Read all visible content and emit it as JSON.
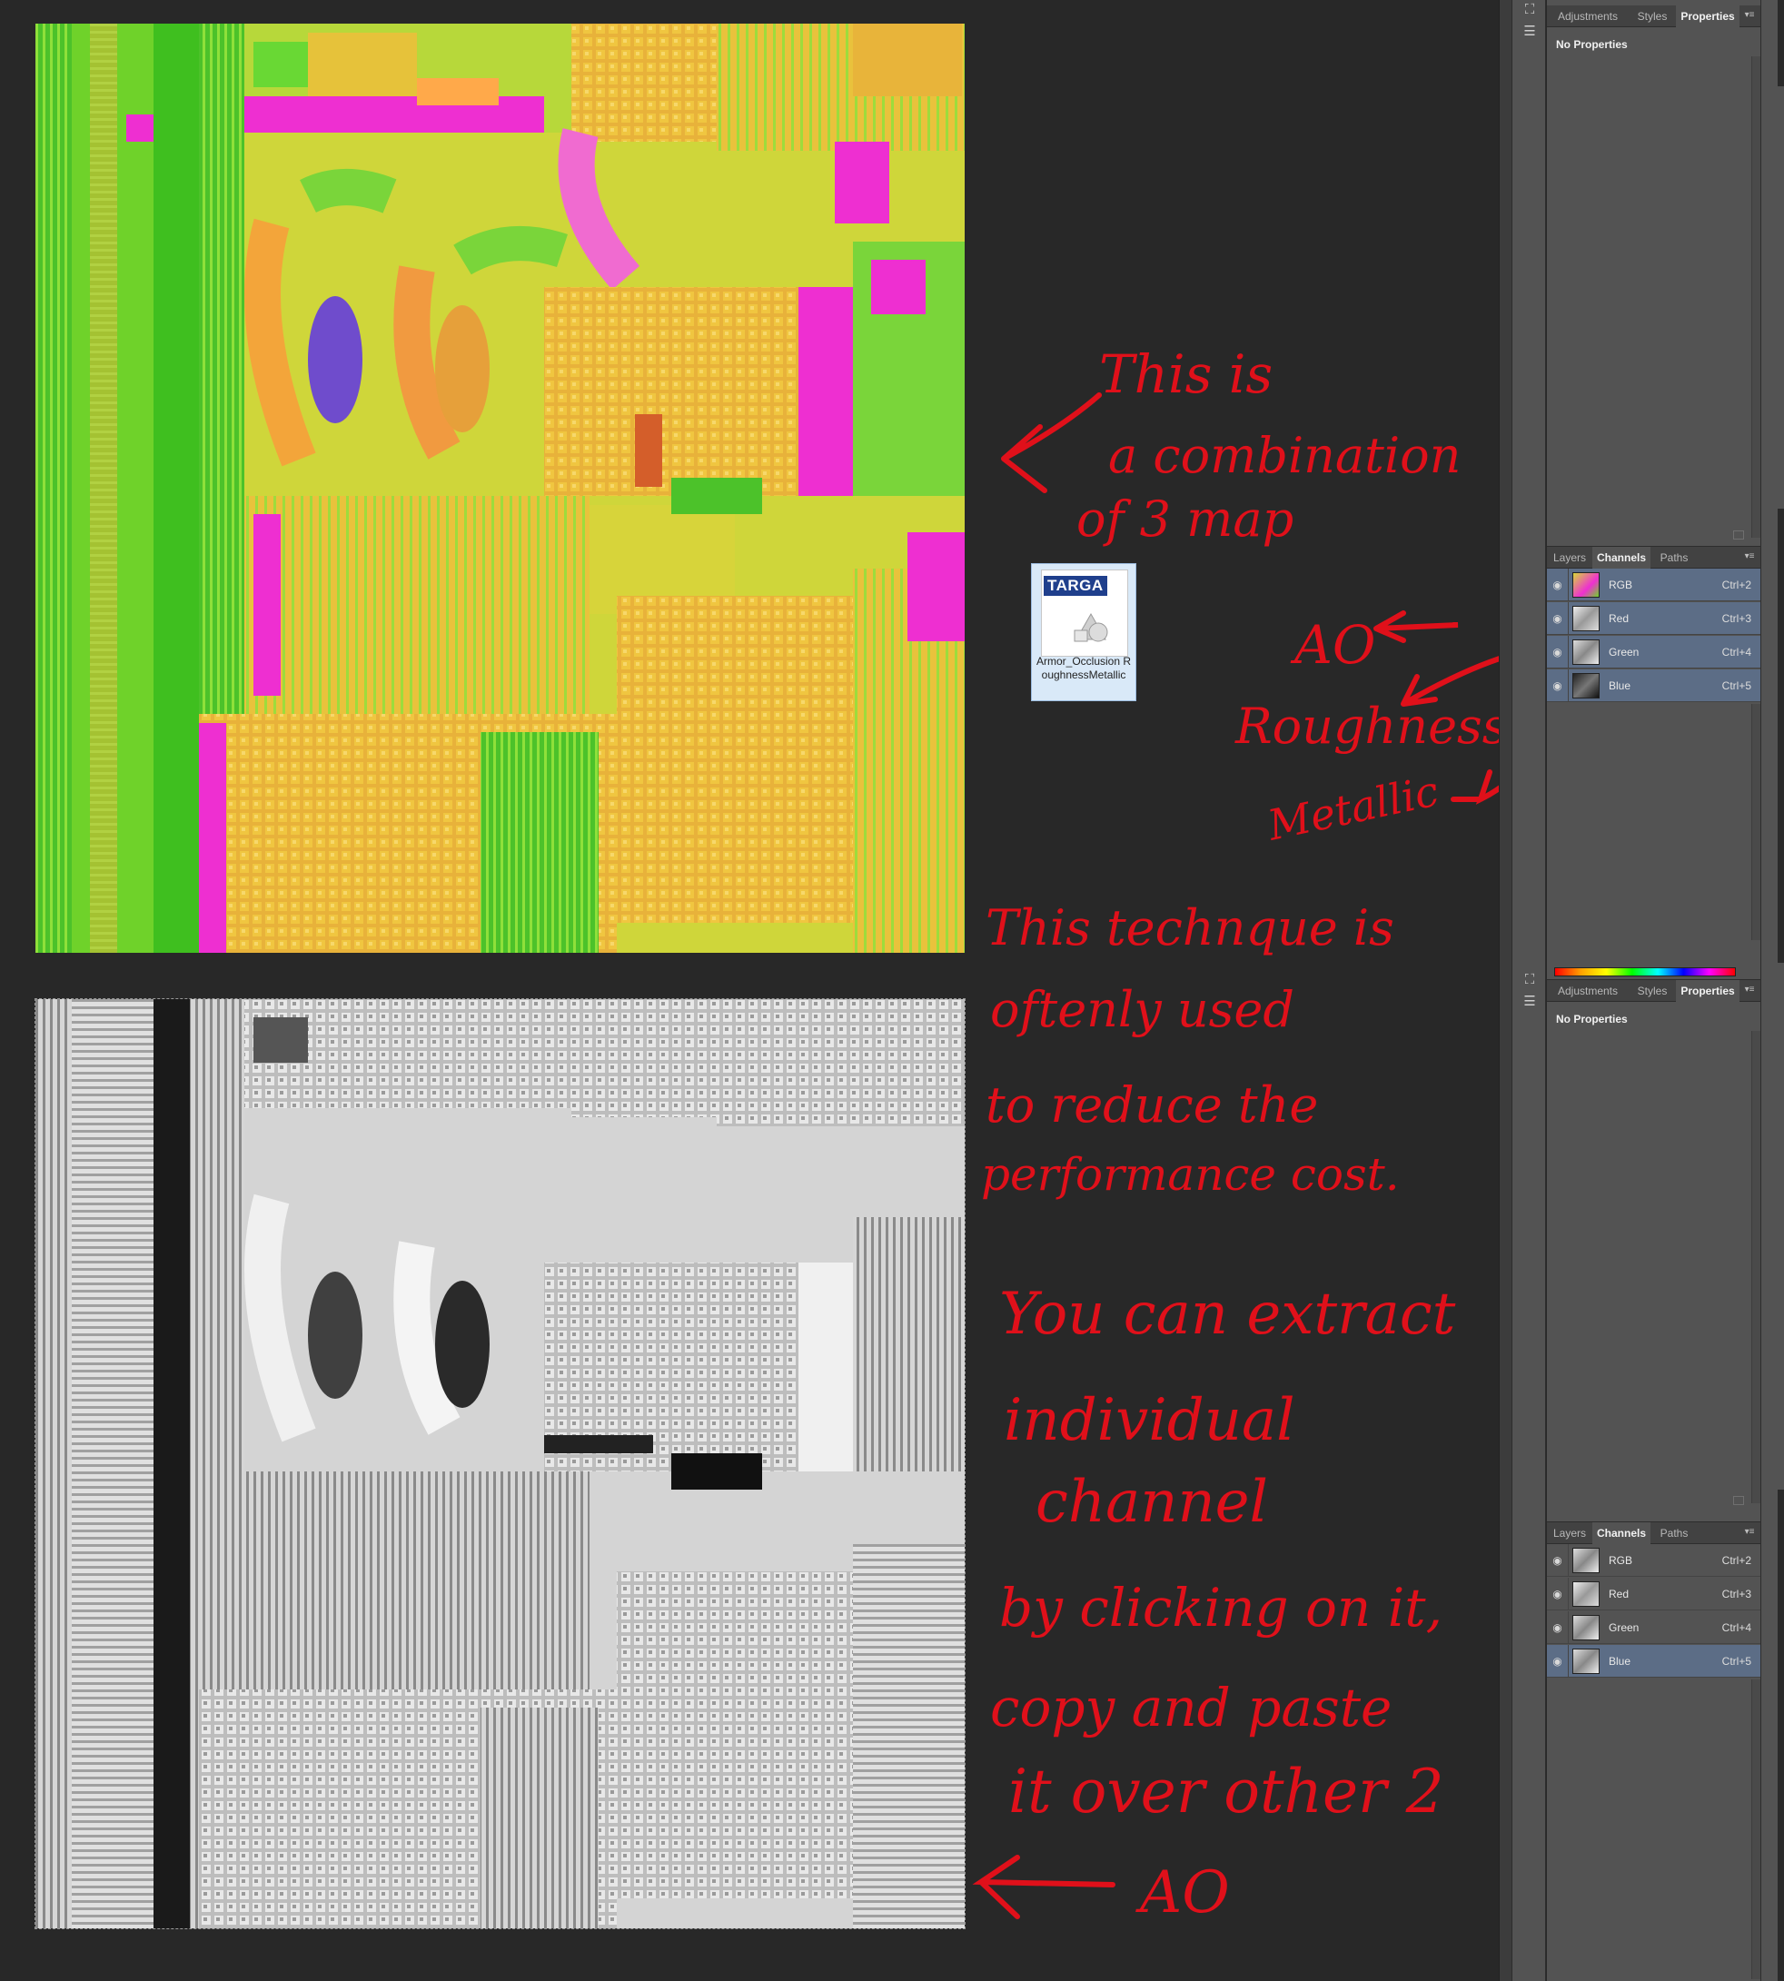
{
  "textures": {
    "combined_alt": "combined AO/Roughness/Metallic texture (yellow-green-pink)",
    "ao_alt": "AO channel grayscale texture"
  },
  "file_icon": {
    "badge": "TARGA",
    "filename": "Armor_Occlusion RoughnessMetallic"
  },
  "annotations": {
    "combo": [
      "This  is",
      "a  combination",
      "of  3 map"
    ],
    "channel_ao": "AO",
    "channel_roughness": "Roughness",
    "channel_metallic": "Metallic",
    "technique": [
      "This  technque is",
      "oftenly  used",
      "to  reduce  the",
      "performance  cost."
    ],
    "extract": [
      "You can  extract",
      "individual",
      "channel",
      "by clicking on it,",
      "copy and  paste",
      "it over other 2"
    ],
    "bottom_ao": "AO",
    "red_two": "2"
  },
  "properties_panel_top": {
    "tabs": [
      "Adjustments",
      "Styles",
      "Properties"
    ],
    "active_tab": "Properties",
    "content": "No Properties"
  },
  "channels_panel_top": {
    "tabs": [
      "Layers",
      "Channels",
      "Paths"
    ],
    "active_tab": "Channels",
    "channels": [
      {
        "name": "RGB",
        "shortcut": "Ctrl+2",
        "selected": true
      },
      {
        "name": "Red",
        "shortcut": "Ctrl+3",
        "selected": true
      },
      {
        "name": "Green",
        "shortcut": "Ctrl+4",
        "selected": true
      },
      {
        "name": "Blue",
        "shortcut": "Ctrl+5",
        "selected": true
      }
    ]
  },
  "properties_panel_bottom": {
    "tabs": [
      "Adjustments",
      "Styles",
      "Properties"
    ],
    "active_tab": "Properties",
    "content": "No Properties"
  },
  "channels_panel_bottom": {
    "tabs": [
      "Layers",
      "Channels",
      "Paths"
    ],
    "active_tab": "Channels",
    "channels": [
      {
        "name": "RGB",
        "shortcut": "Ctrl+2",
        "selected": false
      },
      {
        "name": "Red",
        "shortcut": "Ctrl+3",
        "selected": false
      },
      {
        "name": "Green",
        "shortcut": "Ctrl+4",
        "selected": false
      },
      {
        "name": "Blue",
        "shortcut": "Ctrl+5",
        "selected": true
      }
    ]
  },
  "colors": {
    "annotation_red": "#e0101a",
    "selected_row": "#5c6d86",
    "panel_bg": "#535353",
    "canvas_bg": "#282828"
  }
}
